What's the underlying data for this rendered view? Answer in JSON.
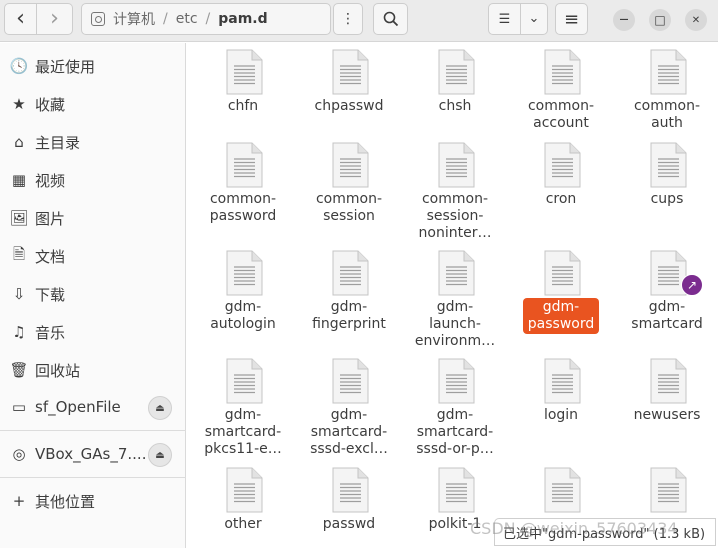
{
  "header": {
    "back_icon": "‹",
    "forward_icon": "›",
    "path": [
      "计算机",
      "etc",
      "pam.d"
    ],
    "path_separator": "/",
    "menu_icon": "⋮",
    "search_icon": "⚲",
    "view_icon": "☰",
    "view_dropdown_icon": "⌄",
    "main_menu_icon": "≡",
    "minimize_icon": "—",
    "maximize_icon": "□",
    "close_icon": "✕"
  },
  "sidebar": {
    "items": [
      {
        "label": "最近使用",
        "icon": "🕓"
      },
      {
        "label": "收藏",
        "icon": "★"
      },
      {
        "label": "主目录",
        "icon": "⌂"
      },
      {
        "label": "视频",
        "icon": "▦"
      },
      {
        "label": "图片",
        "icon": "🖼"
      },
      {
        "label": "文档",
        "icon": "🗎"
      },
      {
        "label": "下载",
        "icon": "⇩"
      },
      {
        "label": "音乐",
        "icon": "♫"
      },
      {
        "label": "回收站",
        "icon": "🗑"
      }
    ],
    "devices": [
      {
        "label": "sf_OpenFile",
        "icon": "▭",
        "eject": "⏏"
      },
      {
        "label": "VBox_GAs_7....",
        "icon": "◎",
        "eject": "⏏"
      }
    ],
    "other": {
      "label": "其他位置",
      "icon": "+"
    }
  },
  "files": [
    {
      "label": "chfn"
    },
    {
      "label": "chpasswd"
    },
    {
      "label": "chsh"
    },
    {
      "label": "common-\naccount"
    },
    {
      "label": "common-\nauth"
    },
    {
      "label": "common-\npassword"
    },
    {
      "label": "common-\nsession"
    },
    {
      "label": "common-\nsession-\nnoninter…"
    },
    {
      "label": "cron"
    },
    {
      "label": "cups"
    },
    {
      "label": "gdm-\nautologin"
    },
    {
      "label": "gdm-\nfingerprint"
    },
    {
      "label": "gdm-\nlaunch-\nenvironm…"
    },
    {
      "label": "gdm-\npassword",
      "selected": true
    },
    {
      "label": "gdm-\nsmartcard",
      "emblem": "↗"
    },
    {
      "label": "gdm-\nsmartcard-\npkcs11-e…"
    },
    {
      "label": "gdm-\nsmartcard-\nsssd-excl…"
    },
    {
      "label": "gdm-\nsmartcard-\nsssd-or-p…"
    },
    {
      "label": "login"
    },
    {
      "label": "newusers"
    },
    {
      "label": "other"
    },
    {
      "label": "passwd"
    },
    {
      "label": "polkit-1"
    },
    {
      "label": ""
    },
    {
      "label": ""
    }
  ],
  "status": {
    "text": "已选中\"gdm-password\" (1.3 kB)"
  },
  "watermark": "CSDN @weixin_57603434",
  "colors": {
    "selection": "#e95420",
    "emblem": "#7b2c8f"
  }
}
